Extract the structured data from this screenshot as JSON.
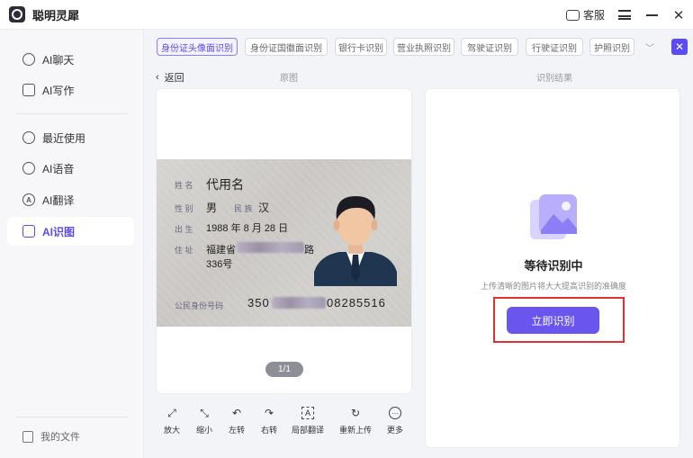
{
  "app": {
    "title": "聪明灵犀"
  },
  "titlebar": {
    "service_label": "客服"
  },
  "sidebar": {
    "items": [
      {
        "label": "AI聊天"
      },
      {
        "label": "AI写作"
      },
      {
        "label": "最近使用"
      },
      {
        "label": "AI语音"
      },
      {
        "label": "AI翻译"
      },
      {
        "label": "AI识图"
      }
    ],
    "files_label": "我的文件"
  },
  "tabs": [
    {
      "label": "身份证头像面识别"
    },
    {
      "label": "身份证国徽面识别"
    },
    {
      "label": "银行卡识别"
    },
    {
      "label": "营业执照识别"
    },
    {
      "label": "驾驶证识别"
    },
    {
      "label": "行驶证识别"
    },
    {
      "label": "护照识别"
    }
  ],
  "header": {
    "back_label": "返回",
    "original_label": "原图",
    "result_label": "识别结果"
  },
  "idcard": {
    "name_label": "姓 名",
    "name": "代用名",
    "gender_label": "性 别",
    "gender": "男",
    "ethnic_label": "民 族",
    "ethnic": "汉",
    "birth_label": "出 生",
    "birth": "1988 年 8 月 28 日",
    "address_label": "住 址",
    "address_prefix": "福建省",
    "address_suffix": "路",
    "address_line2": "336号",
    "id_label": "公民身份号码",
    "id_prefix": "350",
    "id_suffix": "08285516"
  },
  "page_indicator": "1/1",
  "toolbar": [
    {
      "label": "放大",
      "icon": "expand-icon"
    },
    {
      "label": "缩小",
      "icon": "shrink-icon"
    },
    {
      "label": "左转",
      "icon": "rotate-left-icon"
    },
    {
      "label": "右转",
      "icon": "rotate-right-icon"
    },
    {
      "label": "局部翻译",
      "icon": "partial-translate-icon"
    },
    {
      "label": "重新上传",
      "icon": "reupload-icon"
    },
    {
      "label": "更多",
      "icon": "more-icon"
    }
  ],
  "result": {
    "title": "等待识别中",
    "subtitle": "上传清晰的图片将大大提高识别的准确度",
    "button_label": "立即识别"
  },
  "colors": {
    "accent": "#5a4cf0",
    "button": "#6a55ee",
    "highlight": "#e03030"
  }
}
